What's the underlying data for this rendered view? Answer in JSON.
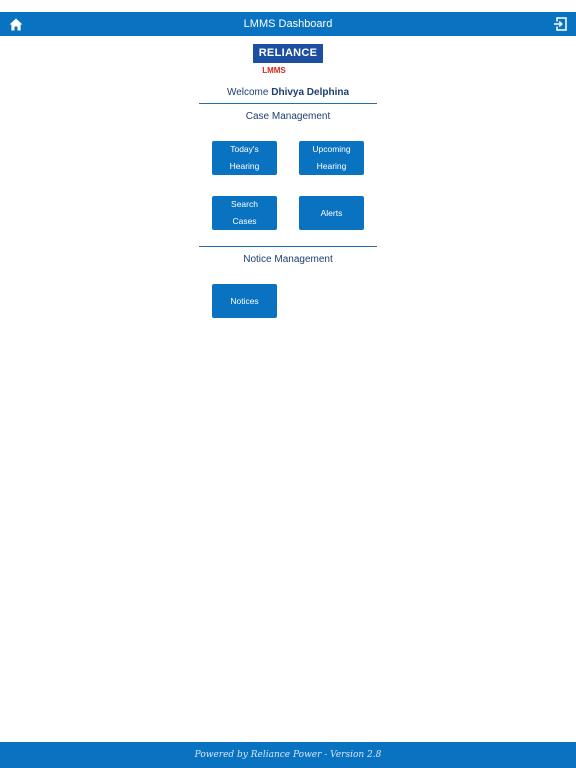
{
  "header": {
    "title": "LMMS Dashboard",
    "home_icon": "home-icon",
    "logout_icon": "logout-icon"
  },
  "logo": {
    "brand": "RELIANCE",
    "product": "LMMS"
  },
  "welcome": {
    "prefix": "Welcome",
    "user_name": "Dhivya Delphina"
  },
  "sections": {
    "case_management": {
      "title": "Case Management",
      "todays_hearing": "Today's Hearing",
      "upcoming_hearing": "Upcoming Hearing",
      "search_cases": "Search Cases",
      "alerts": "Alerts"
    },
    "notice_management": {
      "title": "Notice Management",
      "notices": "Notices"
    }
  },
  "footer": {
    "text": "Powered by Reliance Power - Version 2.8"
  },
  "colors": {
    "primary": "#0a73c1",
    "brand_blue": "#1d4fa0",
    "brand_red": "#d7261e"
  }
}
